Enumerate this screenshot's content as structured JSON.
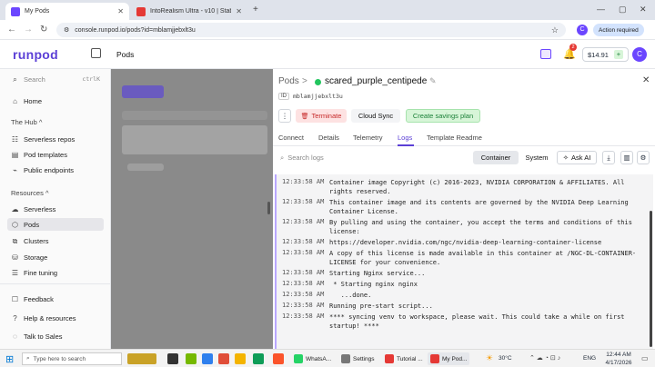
{
  "browser": {
    "tabs": [
      {
        "title": "My Pods",
        "color": "#6b46ff"
      },
      {
        "title": "IntoRealism Ultra - v10 | Stabl",
        "color": "#e53935"
      }
    ],
    "new_tab": "+",
    "url": "console.runpod.io/pods?id=mblamjjebxlt3u",
    "action_required": "Action required",
    "profile": "C"
  },
  "app": {
    "logo": "runpod",
    "page_title": "Pods",
    "balance": "$14.91",
    "notif_count": "2",
    "user_initial": "C"
  },
  "sidebar": {
    "search_placeholder": "Search",
    "search_shortcut": "ctrlK",
    "home": "Home",
    "hub_head": "The Hub",
    "hub_items": [
      "Serverless repos",
      "Pod templates",
      "Public endpoints"
    ],
    "resources_head": "Resources",
    "resources_items": [
      "Serverless",
      "Pods",
      "Clusters",
      "Storage",
      "Fine tuning"
    ],
    "footer_items": [
      "Feedback",
      "Help & resources",
      "Talk to Sales"
    ]
  },
  "drawer": {
    "breadcrumb": "Pods",
    "sep": ">",
    "pod_name": "scared_purple_centipede",
    "id_label": "ID",
    "pod_id": "mblamjjebxlt3u",
    "more": "⋮",
    "terminate": "Terminate",
    "cloud_sync": "Cloud Sync",
    "savings": "Create savings plan",
    "tabs": [
      "Connect",
      "Details",
      "Telemetry",
      "Logs",
      "Template Readme"
    ],
    "log_search_placeholder": "Search logs",
    "container": "Container",
    "system": "System",
    "ask_ai": "Ask AI",
    "logs": [
      {
        "ts": "12:33:58 AM",
        "msg": "Container image Copyright (c) 2016-2023, NVIDIA CORPORATION & AFFILIATES. All rights reserved."
      },
      {
        "ts": "12:33:58 AM",
        "msg": "This container image and its contents are governed by the NVIDIA Deep Learning Container License."
      },
      {
        "ts": "12:33:58 AM",
        "msg": "By pulling and using the container, you accept the terms and conditions of this license:"
      },
      {
        "ts": "12:33:58 AM",
        "msg": "https://developer.nvidia.com/ngc/nvidia-deep-learning-container-license"
      },
      {
        "ts": "12:33:58 AM",
        "msg": "A copy of this license is made available in this container at /NGC-DL-CONTAINER-LICENSE for your convenience."
      },
      {
        "ts": "12:33:58 AM",
        "msg": "Starting Nginx service..."
      },
      {
        "ts": "12:33:58 AM",
        "msg": " * Starting nginx nginx"
      },
      {
        "ts": "12:33:58 AM",
        "msg": "   ...done."
      },
      {
        "ts": "12:33:58 AM",
        "msg": "Running pre-start script..."
      },
      {
        "ts": "12:33:58 AM",
        "msg": "**** syncing venv to workspace, please wait. This could take a while on first startup! ****"
      }
    ]
  },
  "taskbar": {
    "search": "Type here to search",
    "apps": [
      "WhatsA...",
      "Settings",
      "Tutorial ...",
      "My Pod..."
    ],
    "weather": "30°C",
    "lang": "ENG",
    "time": "12:44 AM",
    "date": "4/17/2026"
  },
  "colors": {
    "accent": "#6b46ff",
    "terminate_bg": "#fde2e2",
    "savings_bg": "#d7f5d8",
    "log_border": "#b9a7ff"
  }
}
